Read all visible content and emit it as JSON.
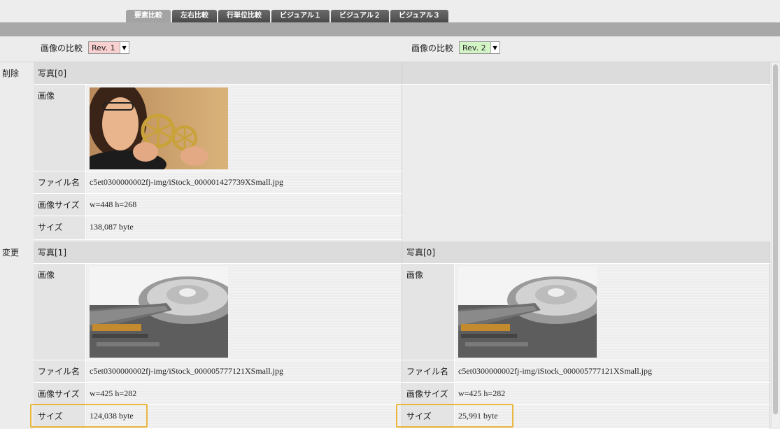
{
  "tabs": [
    {
      "label": "要素比較",
      "active": true
    },
    {
      "label": "左右比較",
      "active": false
    },
    {
      "label": "行単位比較",
      "active": false
    },
    {
      "label": "ビジュアル１",
      "active": false
    },
    {
      "label": "ビジュアル２",
      "active": false
    },
    {
      "label": "ビジュアル３",
      "active": false
    }
  ],
  "left_rev": {
    "label": "画像の比較",
    "value": "Rev. 1",
    "color": "#f9d0d0"
  },
  "right_rev": {
    "label": "画像の比較",
    "value": "Rev. 2",
    "color": "#d3f5c6"
  },
  "sections": {
    "deleted": {
      "label": "削除",
      "left": {
        "header": "写真[0]",
        "image_label": "画像",
        "image_icon": "photo-woman-gears",
        "filename_label": "ファイル名",
        "filename": "c5et0300000002fj-img/iStock_000001427739XSmall.jpg",
        "imgsize_label": "画像サイズ",
        "imgsize": "w=448 h=268",
        "size_label": "サイズ",
        "size": "138,087 byte"
      }
    },
    "changed": {
      "label": "変更",
      "left": {
        "header": "写真[1]",
        "image_label": "画像",
        "image_icon": "photo-hard-drive",
        "filename_label": "ファイル名",
        "filename": "c5et0300000002fj-img/iStock_000005777121XSmall.jpg",
        "imgsize_label": "画像サイズ",
        "imgsize": "w=425 h=282",
        "size_label": "サイズ",
        "size": "124,038 byte"
      },
      "right": {
        "header": "写真[0]",
        "image_label": "画像",
        "image_icon": "photo-hard-drive",
        "filename_label": "ファイル名",
        "filename": "c5et0300000002fj-img/iStock_000005777121XSmall.jpg",
        "imgsize_label": "画像サイズ",
        "imgsize": "w=425 h=282",
        "size_label": "サイズ",
        "size": "25,991 byte"
      }
    }
  },
  "highlight_color": "#e9b640"
}
